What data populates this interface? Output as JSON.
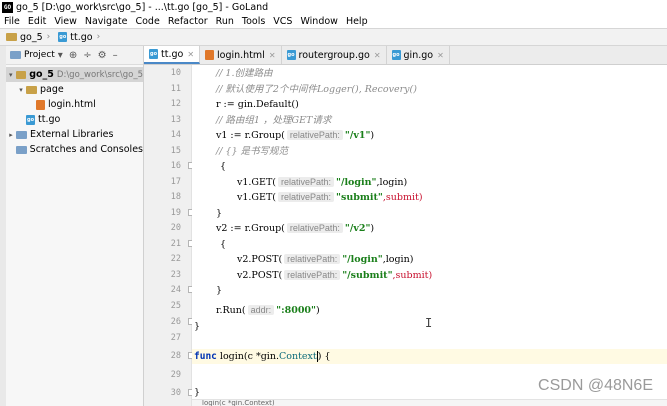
{
  "window": {
    "title": "go_5 [D:\\go_work\\src\\go_5] - ...\\tt.go [go_5] - GoLand",
    "app_icon": "goland-icon"
  },
  "menu": [
    "File",
    "Edit",
    "View",
    "Navigate",
    "Code",
    "Refactor",
    "Run",
    "Tools",
    "VCS",
    "Window",
    "Help"
  ],
  "breadcrumb": {
    "project": "go_5",
    "file": "tt.go"
  },
  "project_panel": {
    "title": "Project",
    "tree": [
      {
        "label": "go_5",
        "path": "D:\\go_work\\src\\go_5"
      },
      {
        "label": "page"
      },
      {
        "label": "login.html"
      },
      {
        "label": "tt.go"
      },
      {
        "label": "External Libraries"
      },
      {
        "label": "Scratches and Consoles"
      }
    ]
  },
  "tabs": [
    "tt.go",
    "login.html",
    "routergroup.go",
    "gin.go"
  ],
  "line_numbers": [
    "10",
    "11",
    "12",
    "13",
    "14",
    "15",
    "16",
    "17",
    "18",
    "19",
    "20",
    "21",
    "22",
    "23",
    "24",
    "25",
    "26",
    "27",
    "28",
    "29",
    "30"
  ],
  "code": {
    "l10": "// 1.创建路由",
    "l11": "// 默认使用了2个中间件Logger(), Recovery()",
    "l12": "r := gin.Default()",
    "l13": "// 路由组1 ，处理GET请求",
    "l14_a": "v1 := r.Group(",
    "l14_hint": "relativePath:",
    "l14_str": "\"/v1\"",
    "l14_b": ")",
    "l15": "// {} 是书写规范",
    "l16": "{",
    "l17_a": "v1.GET(",
    "l17_hint": "relativePath:",
    "l17_str": "\"/login\"",
    "l17_b": ",login)",
    "l18_a": "v1.GET(",
    "l18_hint": "relativePath:",
    "l18_str": "\"submit\"",
    "l18_b": ",submit)",
    "l19": "}",
    "l20_a": "v2 := r.Group(",
    "l20_hint": "relativePath:",
    "l20_str": "\"/v2\"",
    "l20_b": ")",
    "l21": "{",
    "l22_a": "v2.POST(",
    "l22_hint": "relativePath:",
    "l22_str": "\"/login\"",
    "l22_b": ",login)",
    "l23_a": "v2.POST(",
    "l23_hint": "relativePath:",
    "l23_str": "\"/submit\"",
    "l23_b": ",submit)",
    "l24": "}",
    "l25_a": "r.Run(",
    "l25_hint": "addr:",
    "l25_str": "\":8000\"",
    "l25_b": ")",
    "l26": "}",
    "l28_kw": "func",
    "l28_a": "login(c *gin.",
    "l28_b": "Context",
    "l28_c": ")   {",
    "l30": "}"
  },
  "status_hint": "login(c *gin.Context)",
  "watermark": "CSDN @48N6E"
}
